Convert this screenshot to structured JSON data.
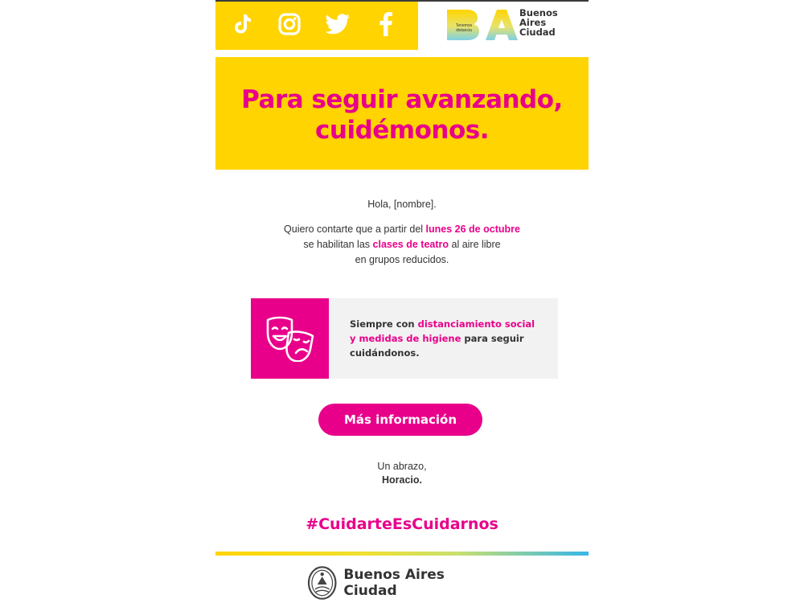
{
  "header": {
    "social": [
      {
        "name": "tiktok-icon"
      },
      {
        "name": "instagram-icon"
      },
      {
        "name": "twitter-icon"
      },
      {
        "name": "facebook-icon"
      }
    ],
    "logo_small_text": "Tenemos distancia",
    "logo_name_line1": "Buenos",
    "logo_name_line2": "Aires",
    "logo_name_line3": "Ciudad"
  },
  "hero": {
    "line1": "Para seguir avanzando,",
    "line2": "cuidémonos."
  },
  "greeting": "Hola, [nombre].",
  "message": {
    "p1_a": "Quiero contarte que a partir del ",
    "p1_highlight": "lunes 26 de octubre",
    "p2_a": "se habilitan las ",
    "p2_highlight": "clases de teatro",
    "p2_b": " al aire libre",
    "p3": "en grupos reducidos."
  },
  "info_box": {
    "icon": "theater-masks-icon",
    "t1": "Siempre con ",
    "t1_highlight": "distanciamiento social",
    "t2_highlight": "y medidas de higiene",
    "t2": " para seguir",
    "t3": "cuidándonos."
  },
  "cta_label": "Más información",
  "signoff": {
    "line1": "Un abrazo,",
    "line2": "Horacio."
  },
  "hashtag": "#CuidarteEsCuidarnos",
  "footer": {
    "brand": "Buenos Aires Ciudad"
  },
  "colors": {
    "yellow": "#ffd401",
    "pink": "#e8008a",
    "light_gray": "#f2f2f2"
  }
}
